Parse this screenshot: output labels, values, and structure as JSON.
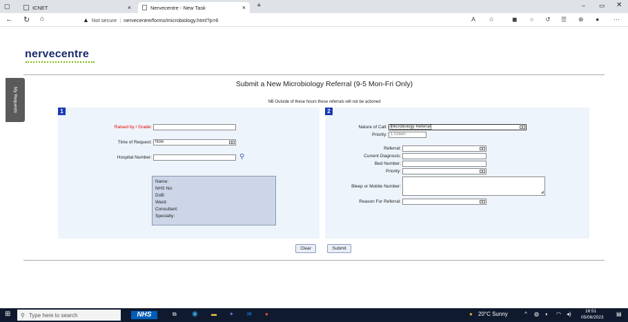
{
  "browser": {
    "tabs": [
      {
        "label": "ICNET"
      },
      {
        "label": "Nervecentre - New Task"
      }
    ],
    "address": {
      "security": "Not secure",
      "url": "nervecentre/forms/microbiology.html?p=6"
    }
  },
  "logo": "nervecentre",
  "side_tab": "My Requests",
  "page": {
    "title": "Submit a New Microbiology Referral (9-5 Mon-Fri Only)",
    "subtitle": "NB Outside of these hours these referrals will not be actioned"
  },
  "section1": {
    "number": "1",
    "raised_by_label": "Raised by / Grade:",
    "time_label": "Time of Request:",
    "time_value": "Now",
    "hospital_label": "Hospital Number:",
    "patient": {
      "name": "Name:",
      "nhs": "NHS No:",
      "dob": "DoB:",
      "ward": "Ward:",
      "consultant": "Consultant:",
      "specialty": "Specialty:"
    }
  },
  "section2": {
    "number": "2",
    "nature_label": "Nature of Call:",
    "nature_value": "Microbiology Referral",
    "priority_label": "Priority:",
    "priority_value": "1 Green",
    "referral_label": "Referral:",
    "diagnosis_label": "Current Diagnosis:",
    "bed_label": "Bed Number:",
    "priority2_label": "Priority:",
    "bleep_label": "Bleep or Mobile Number:",
    "reason_label": "Reason For Referral:"
  },
  "buttons": {
    "clear": "Clear",
    "submit": "Submit"
  },
  "taskbar": {
    "search_placeholder": "Type here to search",
    "nhs": "NHS",
    "weather": "20°C  Sunny",
    "time": "16:51",
    "date": "05/06/2023"
  }
}
